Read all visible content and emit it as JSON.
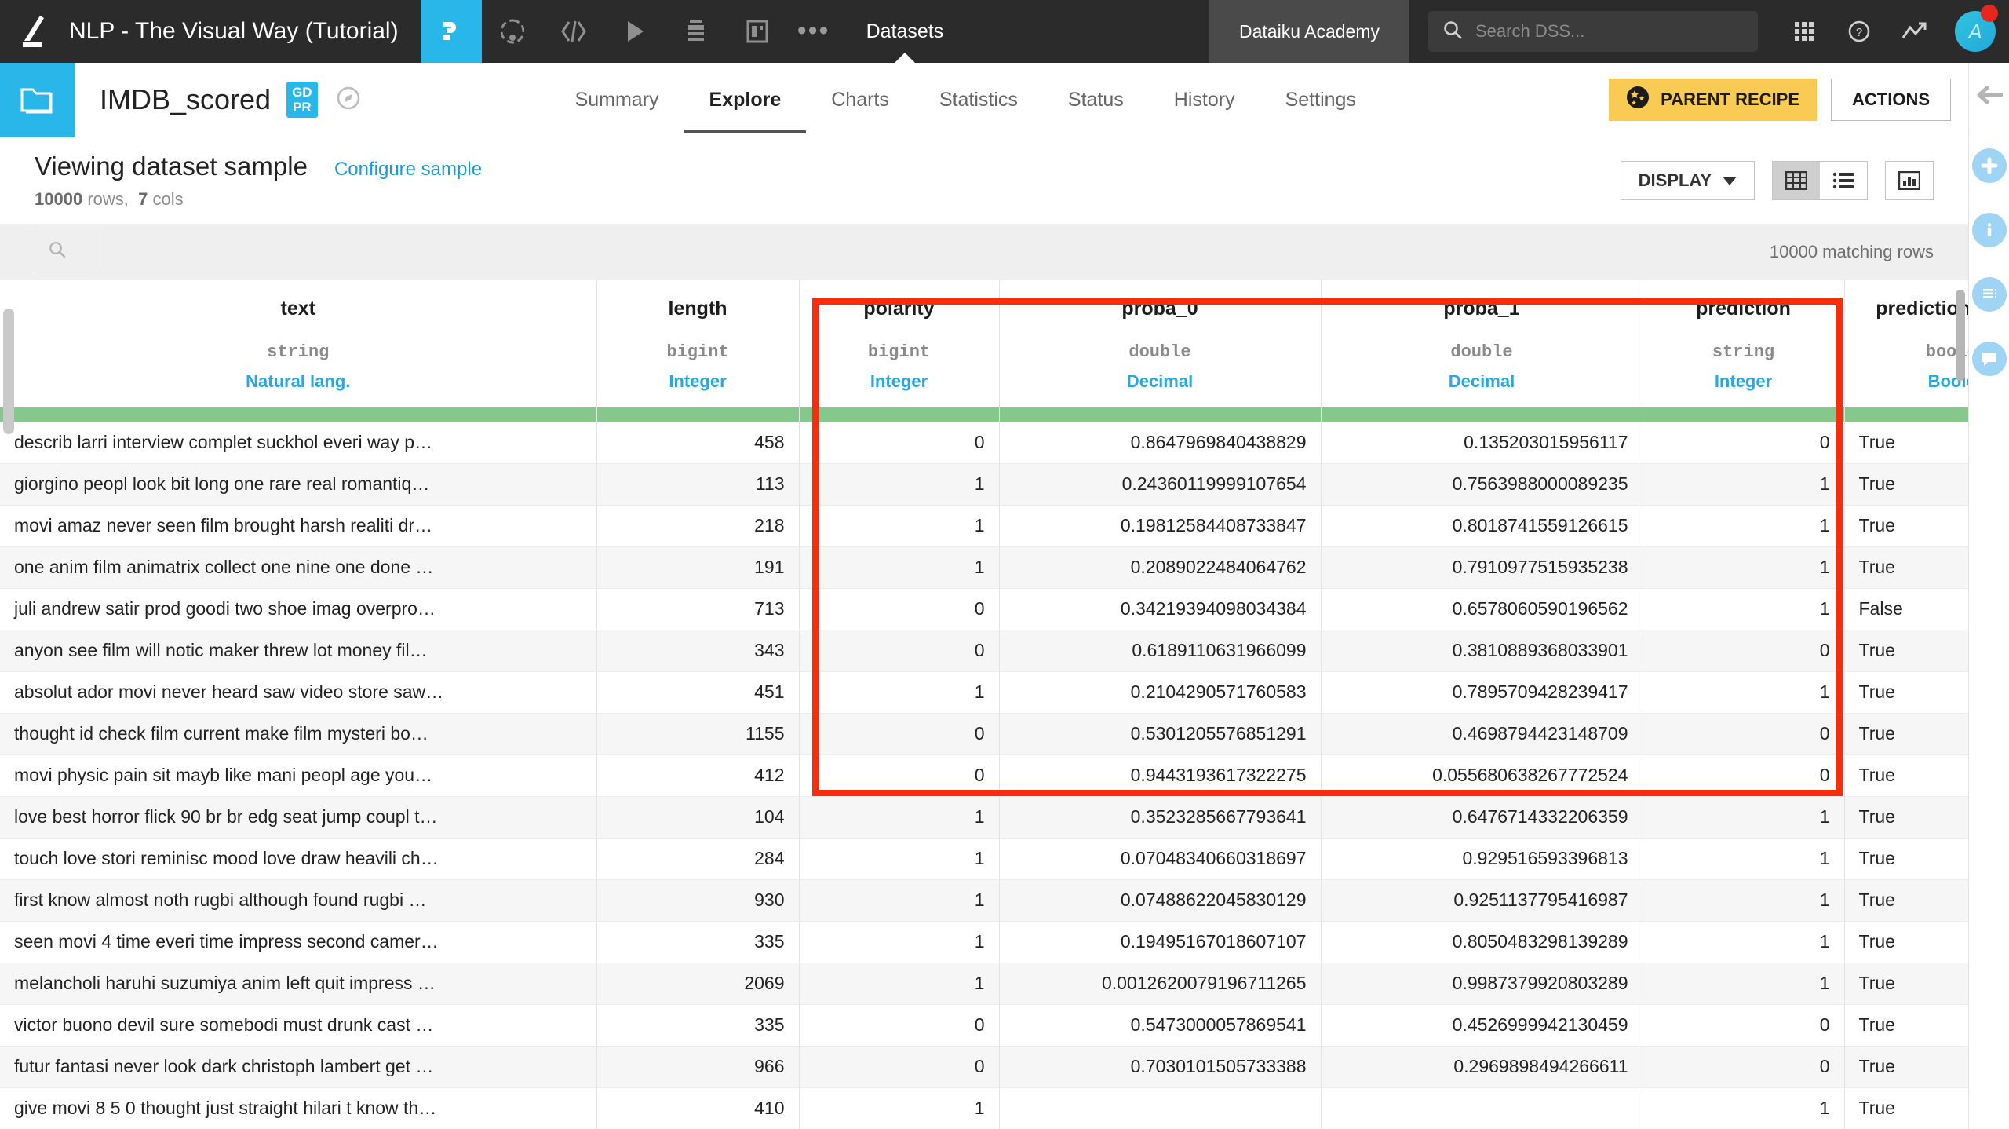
{
  "topbar": {
    "logo_icon": "dataiku-logo-icon",
    "project_name": "NLP - The Visual Way (Tutorial)",
    "nav_icons": [
      {
        "name": "flow-icon",
        "active": true
      },
      {
        "name": "lab-icon",
        "active": false
      },
      {
        "name": "code-icon",
        "active": false
      },
      {
        "name": "jobs-play-icon",
        "active": false
      },
      {
        "name": "automation-icon",
        "active": false
      },
      {
        "name": "dashboard-icon",
        "active": false
      }
    ],
    "more_label": "•••",
    "section_label": "Datasets",
    "academy_label": "Dataiku Academy",
    "search_placeholder": "Search DSS...",
    "search_value": "",
    "apps_icon": "apps-grid-icon",
    "help_icon": "help-question-icon",
    "trend_icon": "trend-up-icon",
    "avatar_initial": "A"
  },
  "dataset_header": {
    "folder_icon": "dataset-folder-icon",
    "title": "IMDB_scored",
    "gdpr_badge_line1": "GD",
    "gdpr_badge_line2": "PR",
    "meaning_icon": "compass-icon",
    "tabs": [
      {
        "label": "Summary",
        "active": false
      },
      {
        "label": "Explore",
        "active": true
      },
      {
        "label": "Charts",
        "active": false
      },
      {
        "label": "Statistics",
        "active": false
      },
      {
        "label": "Status",
        "active": false
      },
      {
        "label": "History",
        "active": false
      },
      {
        "label": "Settings",
        "active": false
      }
    ],
    "parent_recipe_label": "PARENT RECIPE",
    "parent_recipe_icon": "score-recipe-icon",
    "actions_label": "ACTIONS"
  },
  "sample_bar": {
    "title": "Viewing dataset sample",
    "configure_link": "Configure sample",
    "rows_count": "10000",
    "rows_label": "rows,",
    "cols_count": "7",
    "cols_label": "cols",
    "display_label": "DISPLAY",
    "grid_view_icon": "table-grid-icon",
    "list_view_icon": "list-rows-icon",
    "chart_view_icon": "bar-chart-icon"
  },
  "filter_bar": {
    "search_icon": "search-icon",
    "search_value": "",
    "matching_rows": "10000 matching rows"
  },
  "table": {
    "columns": [
      {
        "name": "text",
        "storage": "string",
        "meaning": "Natural lang.",
        "align": "left"
      },
      {
        "name": "length",
        "storage": "bigint",
        "meaning": "Integer",
        "align": "right"
      },
      {
        "name": "polarity",
        "storage": "bigint",
        "meaning": "Integer",
        "align": "right"
      },
      {
        "name": "proba_0",
        "storage": "double",
        "meaning": "Decimal",
        "align": "right"
      },
      {
        "name": "proba_1",
        "storage": "double",
        "meaning": "Decimal",
        "align": "right"
      },
      {
        "name": "prediction",
        "storage": "string",
        "meaning": "Integer",
        "align": "right"
      },
      {
        "name": "prediction_correct",
        "storage": "boolean",
        "meaning": "Boolean",
        "align": "left"
      }
    ],
    "rows": [
      {
        "text": "describ larri interview complet suckhol everi way p…",
        "length": "458",
        "polarity": "0",
        "proba_0": "0.8647969840438829",
        "proba_1": "0.135203015956117",
        "prediction": "0",
        "prediction_correct": "True"
      },
      {
        "text": "giorgino peopl look bit long one rare real romantiq…",
        "length": "113",
        "polarity": "1",
        "proba_0": "0.24360119999107654",
        "proba_1": "0.7563988000089235",
        "prediction": "1",
        "prediction_correct": "True"
      },
      {
        "text": "movi amaz never seen film brought harsh realiti dr…",
        "length": "218",
        "polarity": "1",
        "proba_0": "0.19812584408733847",
        "proba_1": "0.8018741559126615",
        "prediction": "1",
        "prediction_correct": "True"
      },
      {
        "text": "one anim film animatrix collect one nine one done …",
        "length": "191",
        "polarity": "1",
        "proba_0": "0.2089022484064762",
        "proba_1": "0.7910977515935238",
        "prediction": "1",
        "prediction_correct": "True"
      },
      {
        "text": "juli andrew satir prod goodi two shoe imag overpro…",
        "length": "713",
        "polarity": "0",
        "proba_0": "0.34219394098034384",
        "proba_1": "0.6578060590196562",
        "prediction": "1",
        "prediction_correct": "False"
      },
      {
        "text": "anyon see film will notic maker threw lot money fil…",
        "length": "343",
        "polarity": "0",
        "proba_0": "0.6189110631966099",
        "proba_1": "0.3810889368033901",
        "prediction": "0",
        "prediction_correct": "True"
      },
      {
        "text": "absolut ador movi never heard saw video store saw…",
        "length": "451",
        "polarity": "1",
        "proba_0": "0.2104290571760583",
        "proba_1": "0.7895709428239417",
        "prediction": "1",
        "prediction_correct": "True"
      },
      {
        "text": "thought id check film current make film mysteri bo…",
        "length": "1155",
        "polarity": "0",
        "proba_0": "0.5301205576851291",
        "proba_1": "0.4698794423148709",
        "prediction": "0",
        "prediction_correct": "True"
      },
      {
        "text": "movi physic pain sit mayb like mani peopl age you…",
        "length": "412",
        "polarity": "0",
        "proba_0": "0.9443193617322275",
        "proba_1": "0.055680638267772524",
        "prediction": "0",
        "prediction_correct": "True"
      },
      {
        "text": "love best horror flick 90 br br edg seat jump coupl t…",
        "length": "104",
        "polarity": "1",
        "proba_0": "0.3523285667793641",
        "proba_1": "0.6476714332206359",
        "prediction": "1",
        "prediction_correct": "True"
      },
      {
        "text": "touch love stori reminisc mood love draw heavili ch…",
        "length": "284",
        "polarity": "1",
        "proba_0": "0.07048340660318697",
        "proba_1": "0.929516593396813",
        "prediction": "1",
        "prediction_correct": "True"
      },
      {
        "text": "first know almost noth rugbi although found rugbi …",
        "length": "930",
        "polarity": "1",
        "proba_0": "0.07488622045830129",
        "proba_1": "0.9251137795416987",
        "prediction": "1",
        "prediction_correct": "True"
      },
      {
        "text": "seen movi 4 time everi time impress second camer…",
        "length": "335",
        "polarity": "1",
        "proba_0": "0.19495167018607107",
        "proba_1": "0.8050483298139289",
        "prediction": "1",
        "prediction_correct": "True"
      },
      {
        "text": "melancholi haruhi suzumiya anim left quit impress …",
        "length": "2069",
        "polarity": "1",
        "proba_0": "0.0012620079196711265",
        "proba_1": "0.9987379920803289",
        "prediction": "1",
        "prediction_correct": "True"
      },
      {
        "text": "victor buono devil sure somebodi must drunk cast …",
        "length": "335",
        "polarity": "0",
        "proba_0": "0.5473000057869541",
        "proba_1": "0.4526999942130459",
        "prediction": "0",
        "prediction_correct": "True"
      },
      {
        "text": "futur fantasi never look dark christoph lambert get …",
        "length": "966",
        "polarity": "0",
        "proba_0": "0.7030101505733388",
        "proba_1": "0.2969898494266611",
        "prediction": "0",
        "prediction_correct": "True"
      },
      {
        "text": "give movi 8 5 0 thought just straight hilari t know th…",
        "length": "410",
        "polarity": "1",
        "proba_0": "",
        "proba_1": "",
        "prediction": "1",
        "prediction_correct": "True"
      }
    ]
  },
  "annotation": {
    "highlight_box_color": "#fb2c0a",
    "highlight_box_name": "prediction-columns-highlight"
  },
  "right_rail": {
    "back_icon": "collapse-left-arrow-icon",
    "items": [
      {
        "name": "add-icon"
      },
      {
        "name": "info-icon"
      },
      {
        "name": "details-list-icon"
      },
      {
        "name": "discussions-icon"
      }
    ]
  },
  "colors": {
    "accent_blue": "#29b6e8",
    "nav_dark": "#2b2b2b",
    "header_green": "#84c98b",
    "yellow": "#f9cb52",
    "link_blue": "#1b9ad6"
  }
}
